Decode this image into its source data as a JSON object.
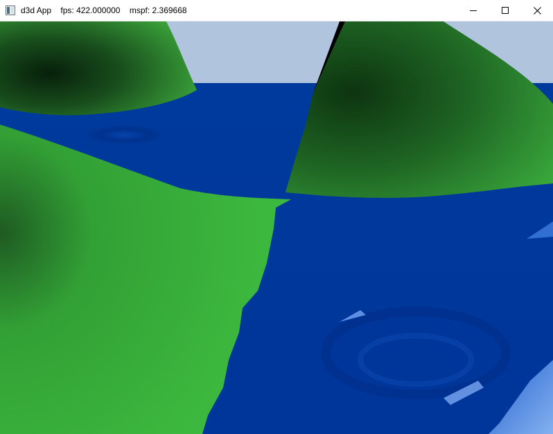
{
  "window": {
    "title": "d3d App",
    "fps_label": "fps:",
    "fps_value": "422.000000",
    "mspf_label": "mspf:",
    "mspf_value": "2.369668"
  },
  "controls": {
    "minimize_icon": "minimize-icon",
    "maximize_icon": "maximize-icon",
    "close_icon": "close-icon"
  },
  "scene": {
    "sky_color": "#b0c4de",
    "water_color": "#0038a0",
    "land_color": "#3cb43c",
    "hill_dark_color": "#0f3a12"
  }
}
